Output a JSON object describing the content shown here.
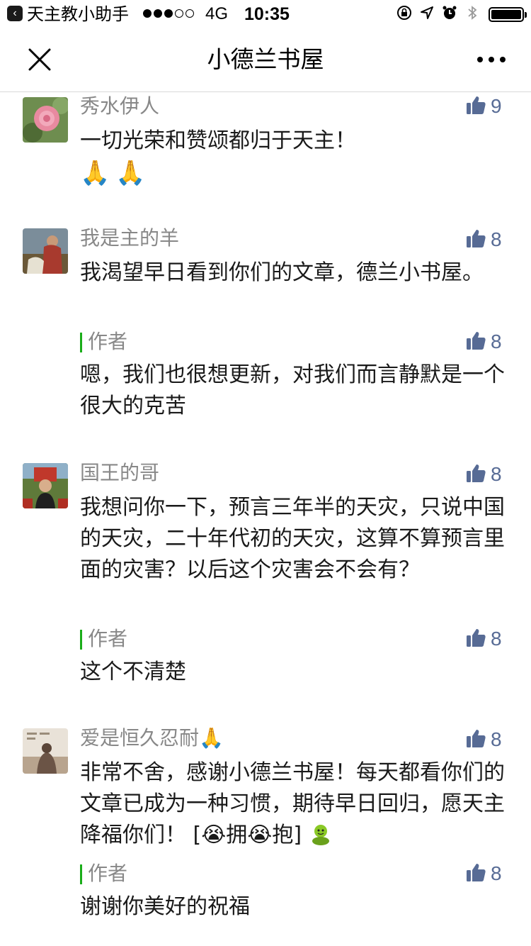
{
  "status_bar": {
    "back_app": "天主教小助手",
    "network": "4G",
    "time": "10:35"
  },
  "nav": {
    "title": "小德兰书屋"
  },
  "comments": [
    {
      "nickname": "秀水伊人",
      "likes": "9",
      "text": "一切光荣和赞颂都归于天主！",
      "emoji_line": "🙏🙏"
    },
    {
      "nickname": "我是主的羊",
      "likes": "8",
      "text": "我渴望早日看到你们的文章，德兰小书屋。",
      "reply": {
        "author_label": "作者",
        "likes": "8",
        "text": "嗯，我们也很想更新，对我们而言静默是一个很大的克苦"
      }
    },
    {
      "nickname": "国王的哥",
      "likes": "8",
      "text": "我想问你一下，预言三年半的天灾，只说中国的天灾，二十年代初的天灾，这算不算预言里面的灾害？以后这个灾害会不会有？",
      "reply": {
        "author_label": "作者",
        "likes": "8",
        "text": "这个不清楚"
      }
    },
    {
      "nickname": "爱是恒久忍耐",
      "nickname_emoji": "🙏",
      "likes": "8",
      "text": "非常不舍，感谢小德兰书屋！每天都看你们的文章已成为一种习惯，期待早日回归，愿天主降福你们！",
      "text_tail": "[😭拥😭抱]",
      "reply": {
        "author_label": "作者",
        "likes": "8",
        "text": "谢谢你美好的祝福"
      }
    }
  ],
  "colors": {
    "nickname": "#888888",
    "like_count": "#576b95",
    "author_bar": "#1aad19",
    "text": "#1a1a1a"
  }
}
